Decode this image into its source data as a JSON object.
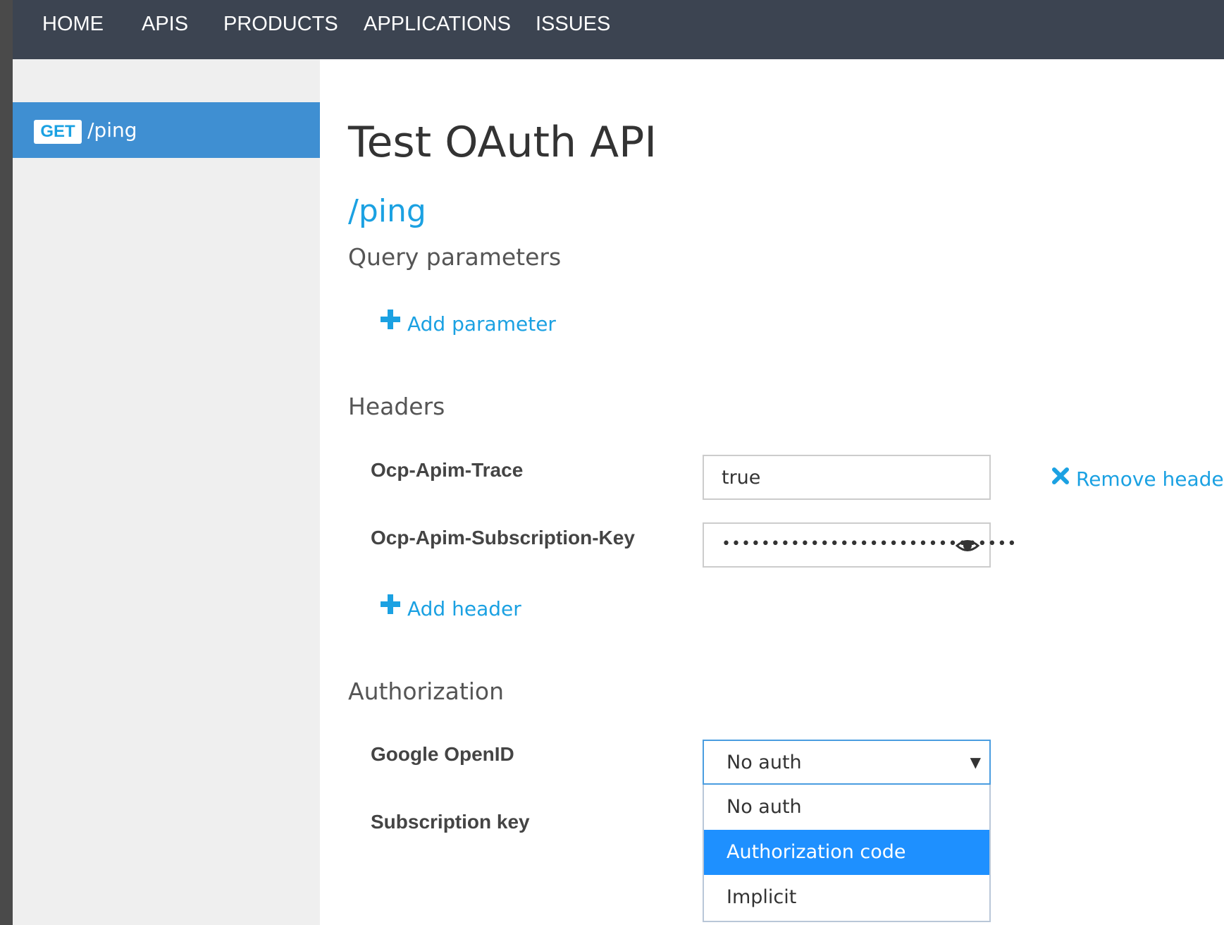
{
  "nav": {
    "items": [
      {
        "label": "HOME"
      },
      {
        "label": "APIS"
      },
      {
        "label": "PRODUCTS"
      },
      {
        "label": "APPLICATIONS"
      },
      {
        "label": "ISSUES"
      }
    ]
  },
  "sidebar": {
    "operations": [
      {
        "method": "GET",
        "path": "/ping",
        "active": true
      }
    ]
  },
  "main": {
    "api_title": "Test OAuth API",
    "operation_title": "/ping",
    "query_parameters": {
      "title": "Query parameters",
      "add_label": "Add parameter"
    },
    "headers": {
      "title": "Headers",
      "items": [
        {
          "name": "Ocp-Apim-Trace",
          "value": "true",
          "remove_label": "Remove header"
        },
        {
          "name": "Ocp-Apim-Subscription-Key",
          "value": "••••••••••••••••••••••••••••••"
        }
      ],
      "add_label": "Add header"
    },
    "authorization": {
      "title": "Authorization",
      "items": [
        {
          "label": "Google OpenID",
          "selected": "No auth"
        },
        {
          "label": "Subscription key"
        }
      ],
      "dropdown_options": [
        "No auth",
        "Authorization code",
        "Implicit"
      ],
      "highlighted_option": "Authorization code"
    }
  },
  "colors": {
    "nav_bg": "#3c4451",
    "sidebar_active": "#3f8fd2",
    "accent": "#1ba1e2",
    "dropdown_highlight": "#1e90ff"
  },
  "icons": {
    "add": "plus-icon",
    "remove": "close-icon",
    "reveal": "eye-icon",
    "dropdown": "dropdown-arrow-icon"
  }
}
